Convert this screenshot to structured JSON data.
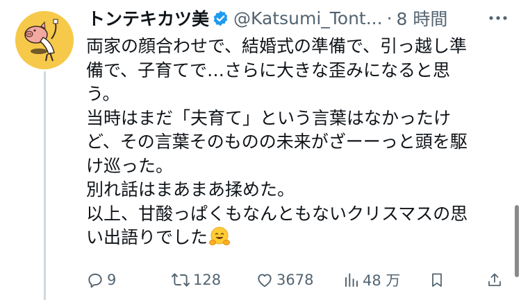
{
  "tweet": {
    "author_name": "トンテキカツ美",
    "handle": "@Katsumi_Tont...",
    "separator": "·",
    "time": "8 時間",
    "body_lines": [
      "両家の顔合わせで、結婚式の準備で、引っ越し準",
      "備で、子育てで…さらに大きな歪みになると思",
      "う。",
      "当時はまだ「夫育て」という言葉はなかったけ",
      "ど、その言葉そのものの未来がざーーっと頭を駆",
      "け巡った。",
      "別れ話はまあまあ揉めた。",
      "以上、甘酸っぱくもなんともないクリスマスの思",
      "い出語りでした"
    ],
    "emoji": "hugging-face-emoji"
  },
  "actions": {
    "replies": "9",
    "retweets": "128",
    "likes": "3678",
    "views": "48 万"
  },
  "colors": {
    "text": "#0f1419",
    "secondary": "#536471",
    "verified": "#1d9bf0",
    "thread_line": "#cfd9de",
    "avatar_bg": "#f6c94a"
  }
}
